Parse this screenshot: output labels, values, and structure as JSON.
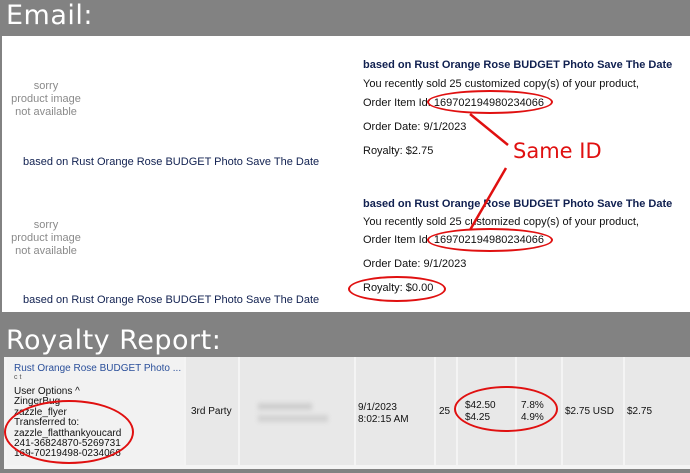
{
  "headings": {
    "email": "Email:",
    "report": "Royalty Report:"
  },
  "emails": [
    {
      "placeholder": [
        "sorry",
        "product image",
        "not available"
      ],
      "left_title": "based on Rust Orange Rose BUDGET Photo Save The Date",
      "title": "based on Rust Orange Rose BUDGET Photo Save The Date",
      "sold_text": "You recently sold 25 customized copy(s) of your product,",
      "order_label": "Order Item Id: ",
      "order_id": "169702194980234066",
      "date": "Order Date: 9/1/2023",
      "royalty": "Royalty: $2.75"
    },
    {
      "placeholder": [
        "sorry",
        "product image",
        "not available"
      ],
      "left_title": "based on Rust Orange Rose BUDGET Photo Save The Date",
      "title": "based on Rust Orange Rose BUDGET Photo Save The Date",
      "sold_text": "You recently sold 25 customized copy(s) of your product,",
      "order_label": "Order Item Id: ",
      "order_id": "169702194980234066",
      "date": "Order Date: 9/1/2023",
      "royalty": "Royalty: $0.00"
    }
  ],
  "annotation": "Same ID",
  "report": {
    "product_link": "Rust Orange Rose BUDGET Photo ...",
    "product_sub": "c t",
    "options_lines": [
      "User Options ^",
      "ZingerBug",
      "zazzle_flyer",
      "Transferred to:",
      "zazzle_flatthankyoucard",
      "241-36824870-5269731",
      "169-70219498-0234066"
    ],
    "party": "3rd Party",
    "date": "9/1/2023",
    "time": "8:02:15 AM",
    "qty": "25",
    "amounts": [
      "$42.50",
      "$4.25"
    ],
    "rates": [
      "7.8%",
      "4.9%"
    ],
    "royalty_usd": "$2.75 USD",
    "royalty": "$2.75"
  },
  "colors": {
    "ring": "#e01010",
    "navy": "#102050",
    "link": "#2a4f9a"
  }
}
